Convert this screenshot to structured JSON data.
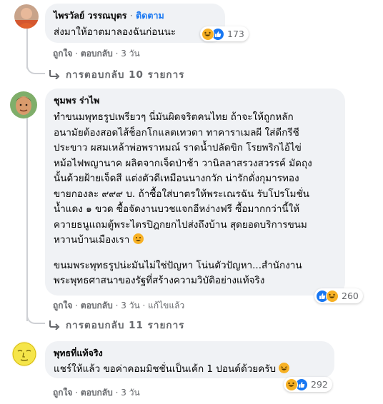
{
  "comments": [
    {
      "author": "ไพรวัลย์ วรรณบุตร",
      "follow": "ติดตาม",
      "lines": [
        "ส่งมาให้อาตมาลองฉันก่อนนะ"
      ],
      "reaction_count": "173",
      "actions": {
        "like": "ถูกใจ",
        "reply": "ตอบกลับ",
        "time": "3 วัน"
      },
      "replies": "การตอบกลับ 10 รายการ"
    },
    {
      "author": "ชุมพร ร่าไพ",
      "lines": [
        "ทำขนมพุทธรูปเพรียวๆ นี่มันผิดจริตคนไทย ถ้าจะให้ถูกหลัก",
        "อนามัยต้องสอดไส้ช็อกโกแลตเทวดา ทาคาราเมลผี ใส่ดีกรีชี",
        "ประขาว ผสมเหล้าพ่อพราหมณ์ ราดน้ำปลัดขิก โรยพริกไอ้ไข่",
        "หม้อไฟพญานาค ผลิตจากเจ็ดป่าช้า วานิลลาสรวงสวรรค์ มัดถุง",
        "นั้นด้วยฝ้ายเจ็ดสี แต่งตัวดีเหมือนนางกวัก น่ารักดั่งกุมารทอง",
        "ขายกองละ ๙๙๙ บ. ถ้าซื้อใส่บาตรให้พระเณรฉัน รับโปรโมชั่น",
        "น้ำแดง ๑ ขวด ซื้อจัดงานบวชแจกอีหง่างฟรี ซื้อมากกว่านี้ให้",
        "ควายธนูแถมตู้พระไตรปิฎกยกไปส่งถึงบ้าน สุดยอดบริการขนม",
        "หวานบ้านเมืองเรา"
      ],
      "lines2": [
        "ขนมพระพุทธรูปน่ะมันไม่ใช่ปัญหา โน่นตัวปัญหา...สำนักงาน",
        "พระพุทธศาสนาของรัฐที่สร้างความวิบัติอย่างแท้จริง"
      ],
      "reaction_count": "260",
      "actions": {
        "like": "ถูกใจ",
        "reply": "ตอบกลับ",
        "time": "3 วัน",
        "edited": "แก้ไขแล้ว"
      },
      "replies": "การตอบกลับ 11 รายการ"
    },
    {
      "author": "พุทธที่แท้จริง",
      "lines": [
        "แชร์ให้แล้ว ขอค่าคอมมิชชั่นเป็นเค้ก 1 ปอนด์ด้วยครับ"
      ],
      "reaction_count": "292",
      "actions": {
        "like": "ถูกใจ",
        "reply": "ตอบกลับ",
        "time": "3 วัน"
      }
    }
  ],
  "separator": "·",
  "icons": {
    "reply_arrow": "reply-arrow-icon",
    "like": "like-icon",
    "haha": "haha-icon"
  },
  "colors": {
    "link": "#1877f2",
    "muted": "#65676b",
    "bubble": "#f0f2f5"
  }
}
